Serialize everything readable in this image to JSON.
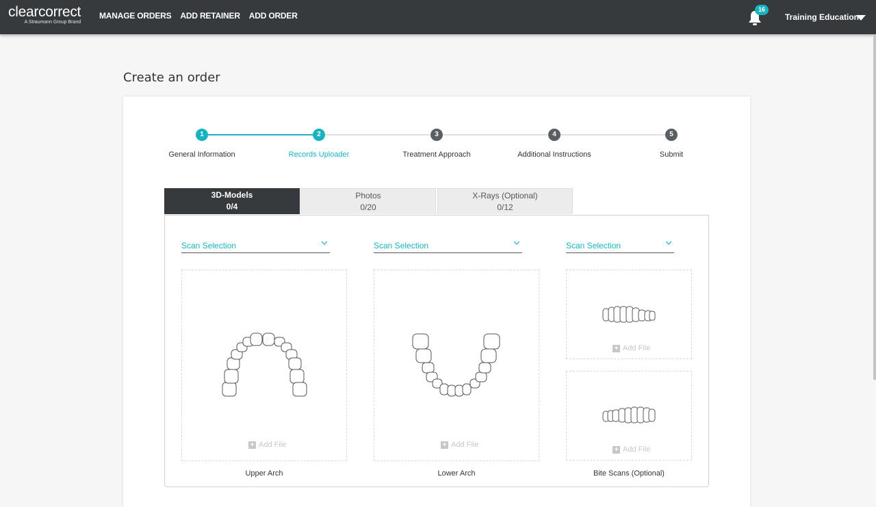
{
  "header": {
    "logo": "clearcorrect",
    "logo_sub": "A Straumann Group Brand",
    "nav": [
      "MANAGE ORDERS",
      "ADD RETAINER",
      "ADD ORDER"
    ],
    "notifications": "16",
    "user": "Training Education"
  },
  "page": {
    "title": "Create an order"
  },
  "stepper": {
    "steps": [
      {
        "num": "1",
        "label": "General Information"
      },
      {
        "num": "2",
        "label": "Records Uploader"
      },
      {
        "num": "3",
        "label": "Treatment Approach"
      },
      {
        "num": "4",
        "label": "Additional Instructions"
      },
      {
        "num": "5",
        "label": "Submit"
      }
    ]
  },
  "tabs": [
    {
      "label": "3D-Models",
      "count": "0/4"
    },
    {
      "label": "Photos",
      "count": "0/20"
    },
    {
      "label": "X-Rays (Optional)",
      "count": "0/12"
    }
  ],
  "uploads": {
    "scan_selection": "Scan Selection",
    "add_file": "Add File",
    "captions": [
      "Upper Arch",
      "Lower Arch",
      "Bite Scans (Optional)"
    ]
  },
  "colors": {
    "accent": "#17b3c0",
    "nav_bg": "#363a3d"
  }
}
